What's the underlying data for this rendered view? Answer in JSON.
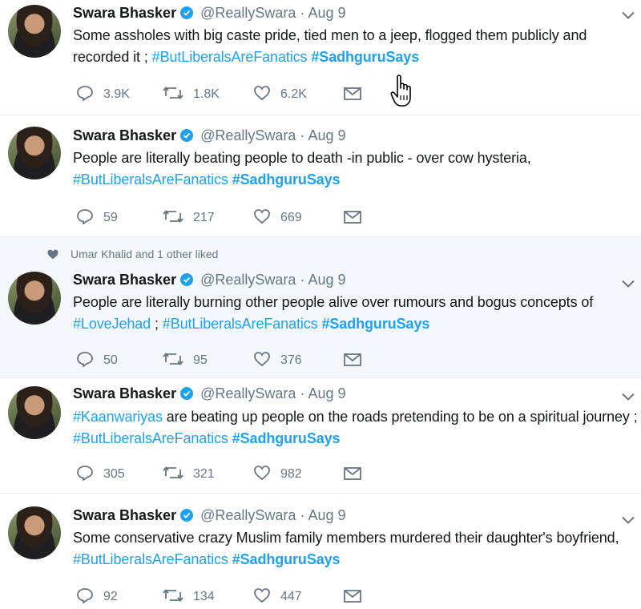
{
  "tweets": [
    {
      "name": "Swara Bhasker",
      "handle": "@ReallySwara",
      "sep": "·",
      "date": "Aug 9",
      "text_parts": [
        {
          "t": "Some assholes with big caste pride, tied men to a jeep, flogged them publicly and recorded it ; ",
          "k": "plain"
        },
        {
          "t": "#ButLiberalsAreFanatics",
          "k": "hashtag"
        },
        {
          "t": " ",
          "k": "plain"
        },
        {
          "t": "#SadhguruSays",
          "k": "hashtag-bold"
        }
      ],
      "replies": "3.9K",
      "retweets": "1.8K",
      "likes": "6.2K"
    },
    {
      "name": "Swara Bhasker",
      "handle": "@ReallySwara",
      "sep": "·",
      "date": "Aug 9",
      "text_parts": [
        {
          "t": "People are literally beating people to death -in public - over cow hysteria, ",
          "k": "plain"
        },
        {
          "t": "#ButLiberalsAreFanatics",
          "k": "hashtag"
        },
        {
          "t": " ",
          "k": "plain"
        },
        {
          "t": "#SadhguruSays",
          "k": "hashtag-bold"
        }
      ],
      "replies": "59",
      "retweets": "217",
      "likes": "669"
    },
    {
      "context": "Umar Khalid and 1 other liked",
      "name": "Swara Bhasker",
      "handle": "@ReallySwara",
      "sep": "·",
      "date": "Aug 9",
      "text_parts": [
        {
          "t": "People are literally burning other people alive over rumours and bogus concepts of ",
          "k": "plain"
        },
        {
          "t": "#LoveJehad",
          "k": "hashtag"
        },
        {
          "t": " ; ",
          "k": "plain"
        },
        {
          "t": "#ButLiberalsAreFanatics",
          "k": "hashtag"
        },
        {
          "t": " ",
          "k": "plain"
        },
        {
          "t": "#SadhguruSays",
          "k": "hashtag-bold"
        }
      ],
      "replies": "50",
      "retweets": "95",
      "likes": "376"
    },
    {
      "name": "Swara Bhasker",
      "handle": "@ReallySwara",
      "sep": "·",
      "date": "Aug 9",
      "text_parts": [
        {
          "t": "#Kaanwariyas",
          "k": "hashtag"
        },
        {
          "t": " are beating up people on the roads pretending to be on a spiritual journey ; ",
          "k": "plain"
        },
        {
          "t": "#ButLiberalsAreFanatics",
          "k": "hashtag"
        },
        {
          "t": " ",
          "k": "plain"
        },
        {
          "t": "#SadhguruSays",
          "k": "hashtag-bold"
        }
      ],
      "replies": "305",
      "retweets": "321",
      "likes": "982"
    },
    {
      "name": "Swara Bhasker",
      "handle": "@ReallySwara",
      "sep": "·",
      "date": "Aug 9",
      "text_parts": [
        {
          "t": "Some conservative crazy Muslim family members murdered their daughter's boyfriend, ",
          "k": "plain"
        },
        {
          "t": "#ButLiberalsAreFanatics",
          "k": "hashtag"
        },
        {
          "t": " ",
          "k": "plain"
        },
        {
          "t": "#SadhguruSays",
          "k": "hashtag-bold"
        }
      ],
      "replies": "92",
      "retweets": "134",
      "likes": "447"
    }
  ],
  "colors": {
    "accent": "#1da1f2",
    "muted": "#657786",
    "context_bg": "#f5f8fa",
    "divider": "#e6ecf0"
  },
  "icons": [
    "verified-badge-icon",
    "chevron-down-icon",
    "reply-icon",
    "retweet-icon",
    "like-icon",
    "direct-message-icon",
    "heart-filled-icon",
    "hand-cursor-icon"
  ]
}
